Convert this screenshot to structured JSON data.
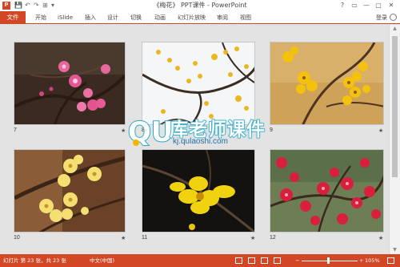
{
  "titlebar": {
    "app_icon": "P",
    "qat": [
      "💾",
      "↶",
      "↷",
      "⊞",
      "▾"
    ],
    "title": "《梅花》 PPT课件 - PowerPoint",
    "window_buttons": [
      "?",
      "▭",
      "—",
      "▢",
      "✕"
    ]
  },
  "ribbon": {
    "file_tab": "文件",
    "tabs": [
      "开始",
      "iSlide",
      "插入",
      "设计",
      "切换",
      "动画",
      "幻灯片放映",
      "审阅",
      "视图"
    ],
    "login": "登录"
  },
  "slides": [
    {
      "number": "7",
      "icon": "plum-blossom-pink-photo"
    },
    {
      "number": "8",
      "icon": "wintersweet-branch-sky-photo"
    },
    {
      "number": "9",
      "icon": "wintersweet-yellow-photo"
    },
    {
      "number": "10",
      "icon": "wintersweet-pale-yellow-photo"
    },
    {
      "number": "11",
      "icon": "wintersweet-dark-photo"
    },
    {
      "number": "12",
      "icon": "plum-blossom-red-photo"
    }
  ],
  "slide_marker": "★",
  "watermark": {
    "logo": "QU",
    "text": "库老师课件",
    "url": "kj.qulaoshi.com"
  },
  "statusbar": {
    "slide_info": "幻灯片 第 23 张，共 23 张",
    "language": "中文(中国)",
    "zoom_minus": "−",
    "zoom_plus": "+",
    "zoom_value": "105%",
    "zoom_level_percent": 45
  },
  "colors": {
    "accent": "#d24726",
    "background": "#e3e3e3"
  }
}
